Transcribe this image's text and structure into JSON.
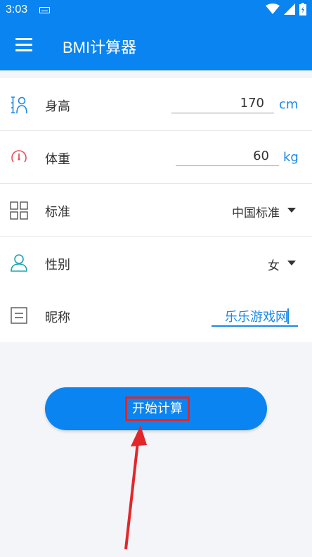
{
  "status_bar": {
    "time": "3:03"
  },
  "app_bar": {
    "title": "BMI计算器",
    "icons": [
      "menu-icon"
    ]
  },
  "form": {
    "height": {
      "label": "身高",
      "value": "170",
      "unit": "cm",
      "icon": "person-height-icon"
    },
    "weight": {
      "label": "体重",
      "value": "60",
      "unit": "kg",
      "icon": "scale-gauge-icon"
    },
    "standard": {
      "label": "标准",
      "value": "中国标准",
      "icon": "grid-icon"
    },
    "gender": {
      "label": "性别",
      "value": "女",
      "icon": "person-icon"
    },
    "nickname": {
      "label": "昵称",
      "value": "乐乐游戏网",
      "icon": "document-icon"
    }
  },
  "actions": {
    "start_label": "开始计算"
  },
  "colors": {
    "primary": "#0a84f0",
    "accent_blue": "#1a88e8",
    "highlight_red": "#e3262a",
    "gauge_red": "#e8505b",
    "person_teal": "#1aa6b0"
  }
}
